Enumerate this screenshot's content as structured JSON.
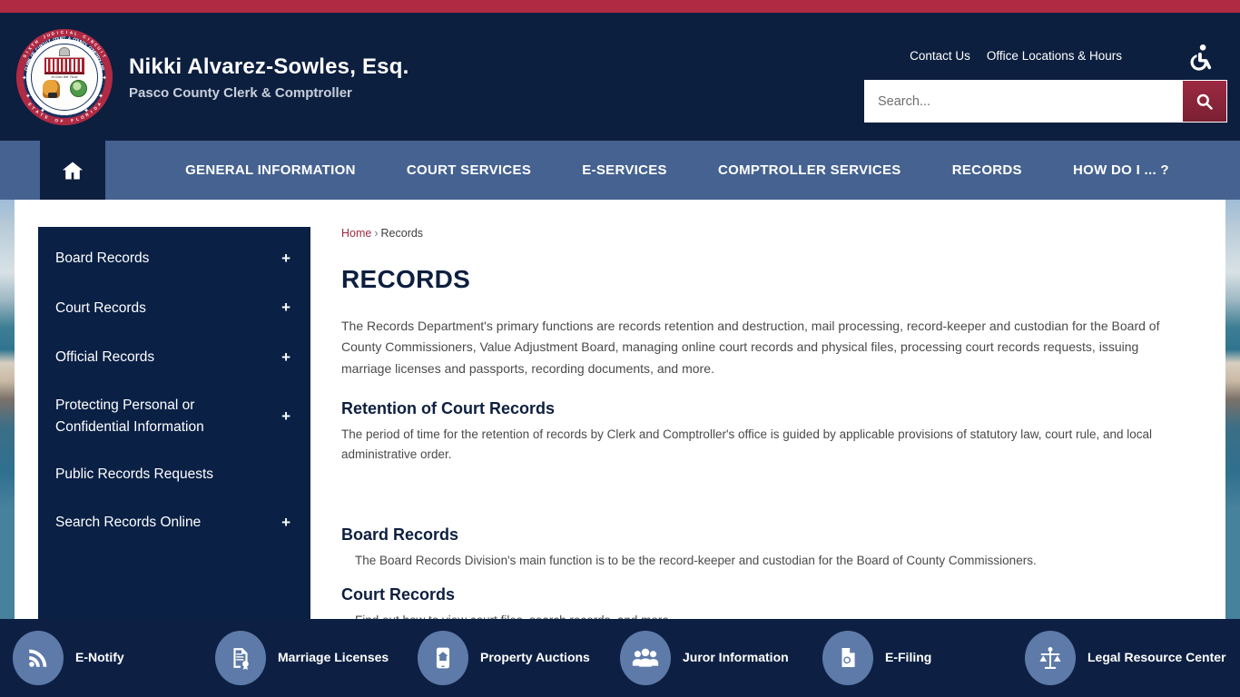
{
  "header": {
    "brand_name": "Nikki Alvarez-Sowles, Esq.",
    "brand_subtitle": "Pasco County Clerk & Comptroller",
    "seal_text_top": "SIXTH JUDICIAL CIRCUIT",
    "seal_text_mid": "CLERK OF CIRCUIT COURT & COUNTY COMPTROLLER",
    "seal_text_bottom": "STATE OF FLORIDA",
    "seal_text_county": "PASCO COUNTY",
    "seal_motto": "In God We Trust",
    "links": [
      {
        "label": "Contact Us"
      },
      {
        "label": "Office Locations & Hours"
      }
    ],
    "accessibility_icon": "wheelchair-accessibility-icon",
    "search": {
      "value": "",
      "placeholder": "Search...",
      "button_icon": "search-icon"
    }
  },
  "nav": {
    "home_icon": "home-icon",
    "items": [
      {
        "label": "GENERAL INFORMATION"
      },
      {
        "label": "COURT SERVICES"
      },
      {
        "label": "E-SERVICES"
      },
      {
        "label": "COMPTROLLER SERVICES"
      },
      {
        "label": "RECORDS"
      },
      {
        "label": "HOW DO I ... ?"
      }
    ]
  },
  "sidebar": {
    "items": [
      {
        "label": "Board Records",
        "expander": "+"
      },
      {
        "label": "Court Records",
        "expander": "+"
      },
      {
        "label": "Official Records",
        "expander": "+"
      },
      {
        "label": "Protecting Personal or Confidential Information",
        "expander": "+"
      },
      {
        "label": "Public Records Requests",
        "expander": ""
      },
      {
        "label": "Search Records Online",
        "expander": "+"
      }
    ]
  },
  "breadcrumb": {
    "home": "Home",
    "separator": "›",
    "current": "Records"
  },
  "main": {
    "title": "RECORDS",
    "intro": "The Records Department's primary functions are records retention and destruction, mail processing, record-keeper and custodian for the Board of County Commissioners, Value Adjustment Board, managing online court records and physical files, processing court records requests, issuing marriage licenses and passports, recording documents, and more.",
    "sections": [
      {
        "heading": "Retention of Court Records",
        "body": "The period of time for the retention of records by Clerk and Comptroller's office is guided by applicable provisions of statutory law, court rule, and local administrative order."
      },
      {
        "heading": "Board Records",
        "body": "The Board Records Division's main function is to be the record-keeper and custodian for the Board of County Commissioners."
      },
      {
        "heading": "Court Records",
        "body": "Find out how to view court files, search records, and more."
      }
    ]
  },
  "quick_links": [
    {
      "label": "E-Notify",
      "icon": "rss-feed-icon"
    },
    {
      "label": "Marriage Licenses",
      "icon": "certificate-document-icon"
    },
    {
      "label": "Property Auctions",
      "icon": "mobile-house-icon"
    },
    {
      "label": "Juror Information",
      "icon": "people-group-icon"
    },
    {
      "label": "E-Filing",
      "icon": "document-search-icon"
    },
    {
      "label": "Legal Resource Center",
      "icon": "scales-of-justice-icon"
    }
  ],
  "colors": {
    "accent_crimson": "#b02a44",
    "header_navy": "#0d1f3f",
    "nav_blue": "#456290",
    "sidebar_navy": "#0a2045",
    "footer_navy": "#0d2043",
    "quick_circle": "#5d7aa8"
  }
}
